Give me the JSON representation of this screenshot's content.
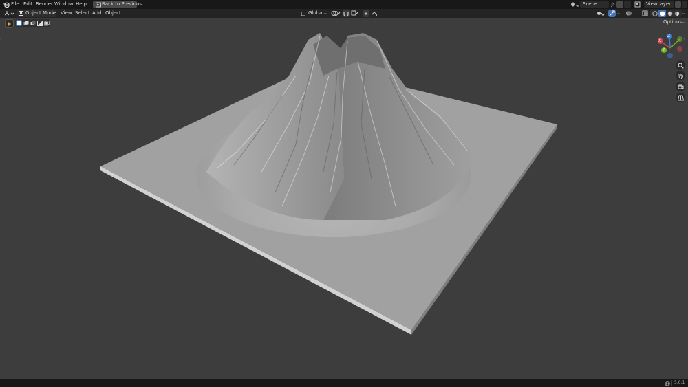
{
  "menu": {
    "items": [
      "File",
      "Edit",
      "Render",
      "Window",
      "Help"
    ],
    "back_button": "Back to Previous",
    "scene_label": "Scene",
    "view_layer_label": "ViewLayer"
  },
  "header": {
    "mode": "Object Mode",
    "menus": [
      "View",
      "Select",
      "Add",
      "Object"
    ],
    "transform_orientation": "Global"
  },
  "toolbar": {
    "options_label": "Options"
  },
  "gizmo": {
    "axes": [
      "Z",
      "Y",
      "X"
    ],
    "colors": {
      "x": "#d94451",
      "y": "#6db32a",
      "z": "#3a80d9"
    }
  },
  "status": {
    "version": "5.0.1"
  },
  "colors": {
    "background": "#3d3d3d",
    "topbar": "#181818",
    "header": "#242424",
    "accent": "#4772b3"
  },
  "icons": {
    "blender_logo": "blender-logo-icon",
    "magnet": "snap-icon",
    "zoom": "zoom-icon",
    "hand": "pan-icon",
    "camera": "camera-icon",
    "grid": "ortho-grid-icon",
    "globe": "globe-icon"
  }
}
